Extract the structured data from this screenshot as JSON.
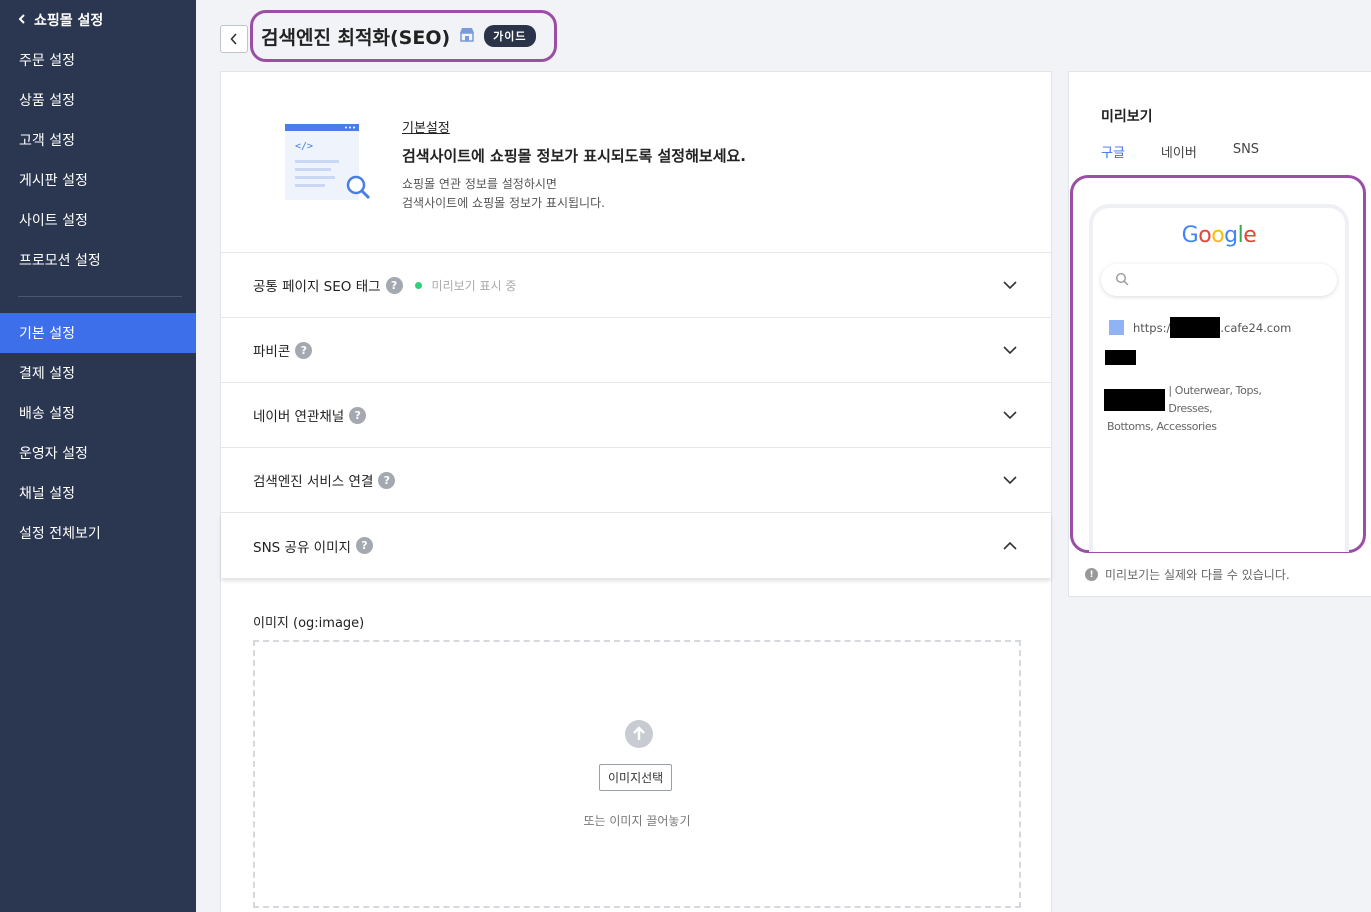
{
  "sidebar": {
    "header": "쇼핑몰 설정",
    "items_top": [
      "주문 설정",
      "상품 설정",
      "고객 설정",
      "게시판 설정",
      "사이트 설정",
      "프로모션 설정"
    ],
    "items_bottom": [
      "기본 설정",
      "결제 설정",
      "배송 설정",
      "운영자 설정",
      "채널 설정",
      "설정 전체보기"
    ],
    "active": "기본 설정"
  },
  "header": {
    "title": "검색엔진 최적화(SEO)",
    "guide_label": "가이드"
  },
  "intro": {
    "label": "기본설정",
    "heading": "검색사이트에 쇼핑몰 정보가 표시되도록 설정해보세요.",
    "desc_line1": "쇼핑몰 연관 정보를 설정하시면",
    "desc_line2": "검색사이트에 쇼핑몰 정보가 표시됩니다."
  },
  "accordion": {
    "items": [
      {
        "label": "공통 페이지 SEO 태그",
        "status": "미리보기 표시 중"
      },
      {
        "label": "파비콘"
      },
      {
        "label": "네이버 연관채널"
      },
      {
        "label": "검색엔진 서비스 연결"
      },
      {
        "label": "SNS 공유 이미지"
      }
    ],
    "help_glyph": "?"
  },
  "image_section": {
    "label": "이미지 (og:image)",
    "select_button": "이미지선택",
    "drag_text": "또는 이미지 끌어놓기"
  },
  "preview": {
    "title": "미리보기",
    "tabs": [
      "구글",
      "네이버",
      "SNS"
    ],
    "active_tab": "구글",
    "logo_letters": [
      "G",
      "o",
      "o",
      "g",
      "l",
      "e"
    ],
    "url_prefix": "https:/",
    "url_suffix": ".cafe24.com",
    "desc_line1": "| Outerwear, Tops, Dresses,",
    "desc_line2": "Bottoms, Accessories",
    "note": "미리보기는 실제와 다를 수 있습니다."
  },
  "colors": {
    "sidebar_bg": "#2b3650",
    "active_blue": "#3e6fea",
    "highlight_purple": "#9b4ea5",
    "status_green": "#2fd07a"
  }
}
